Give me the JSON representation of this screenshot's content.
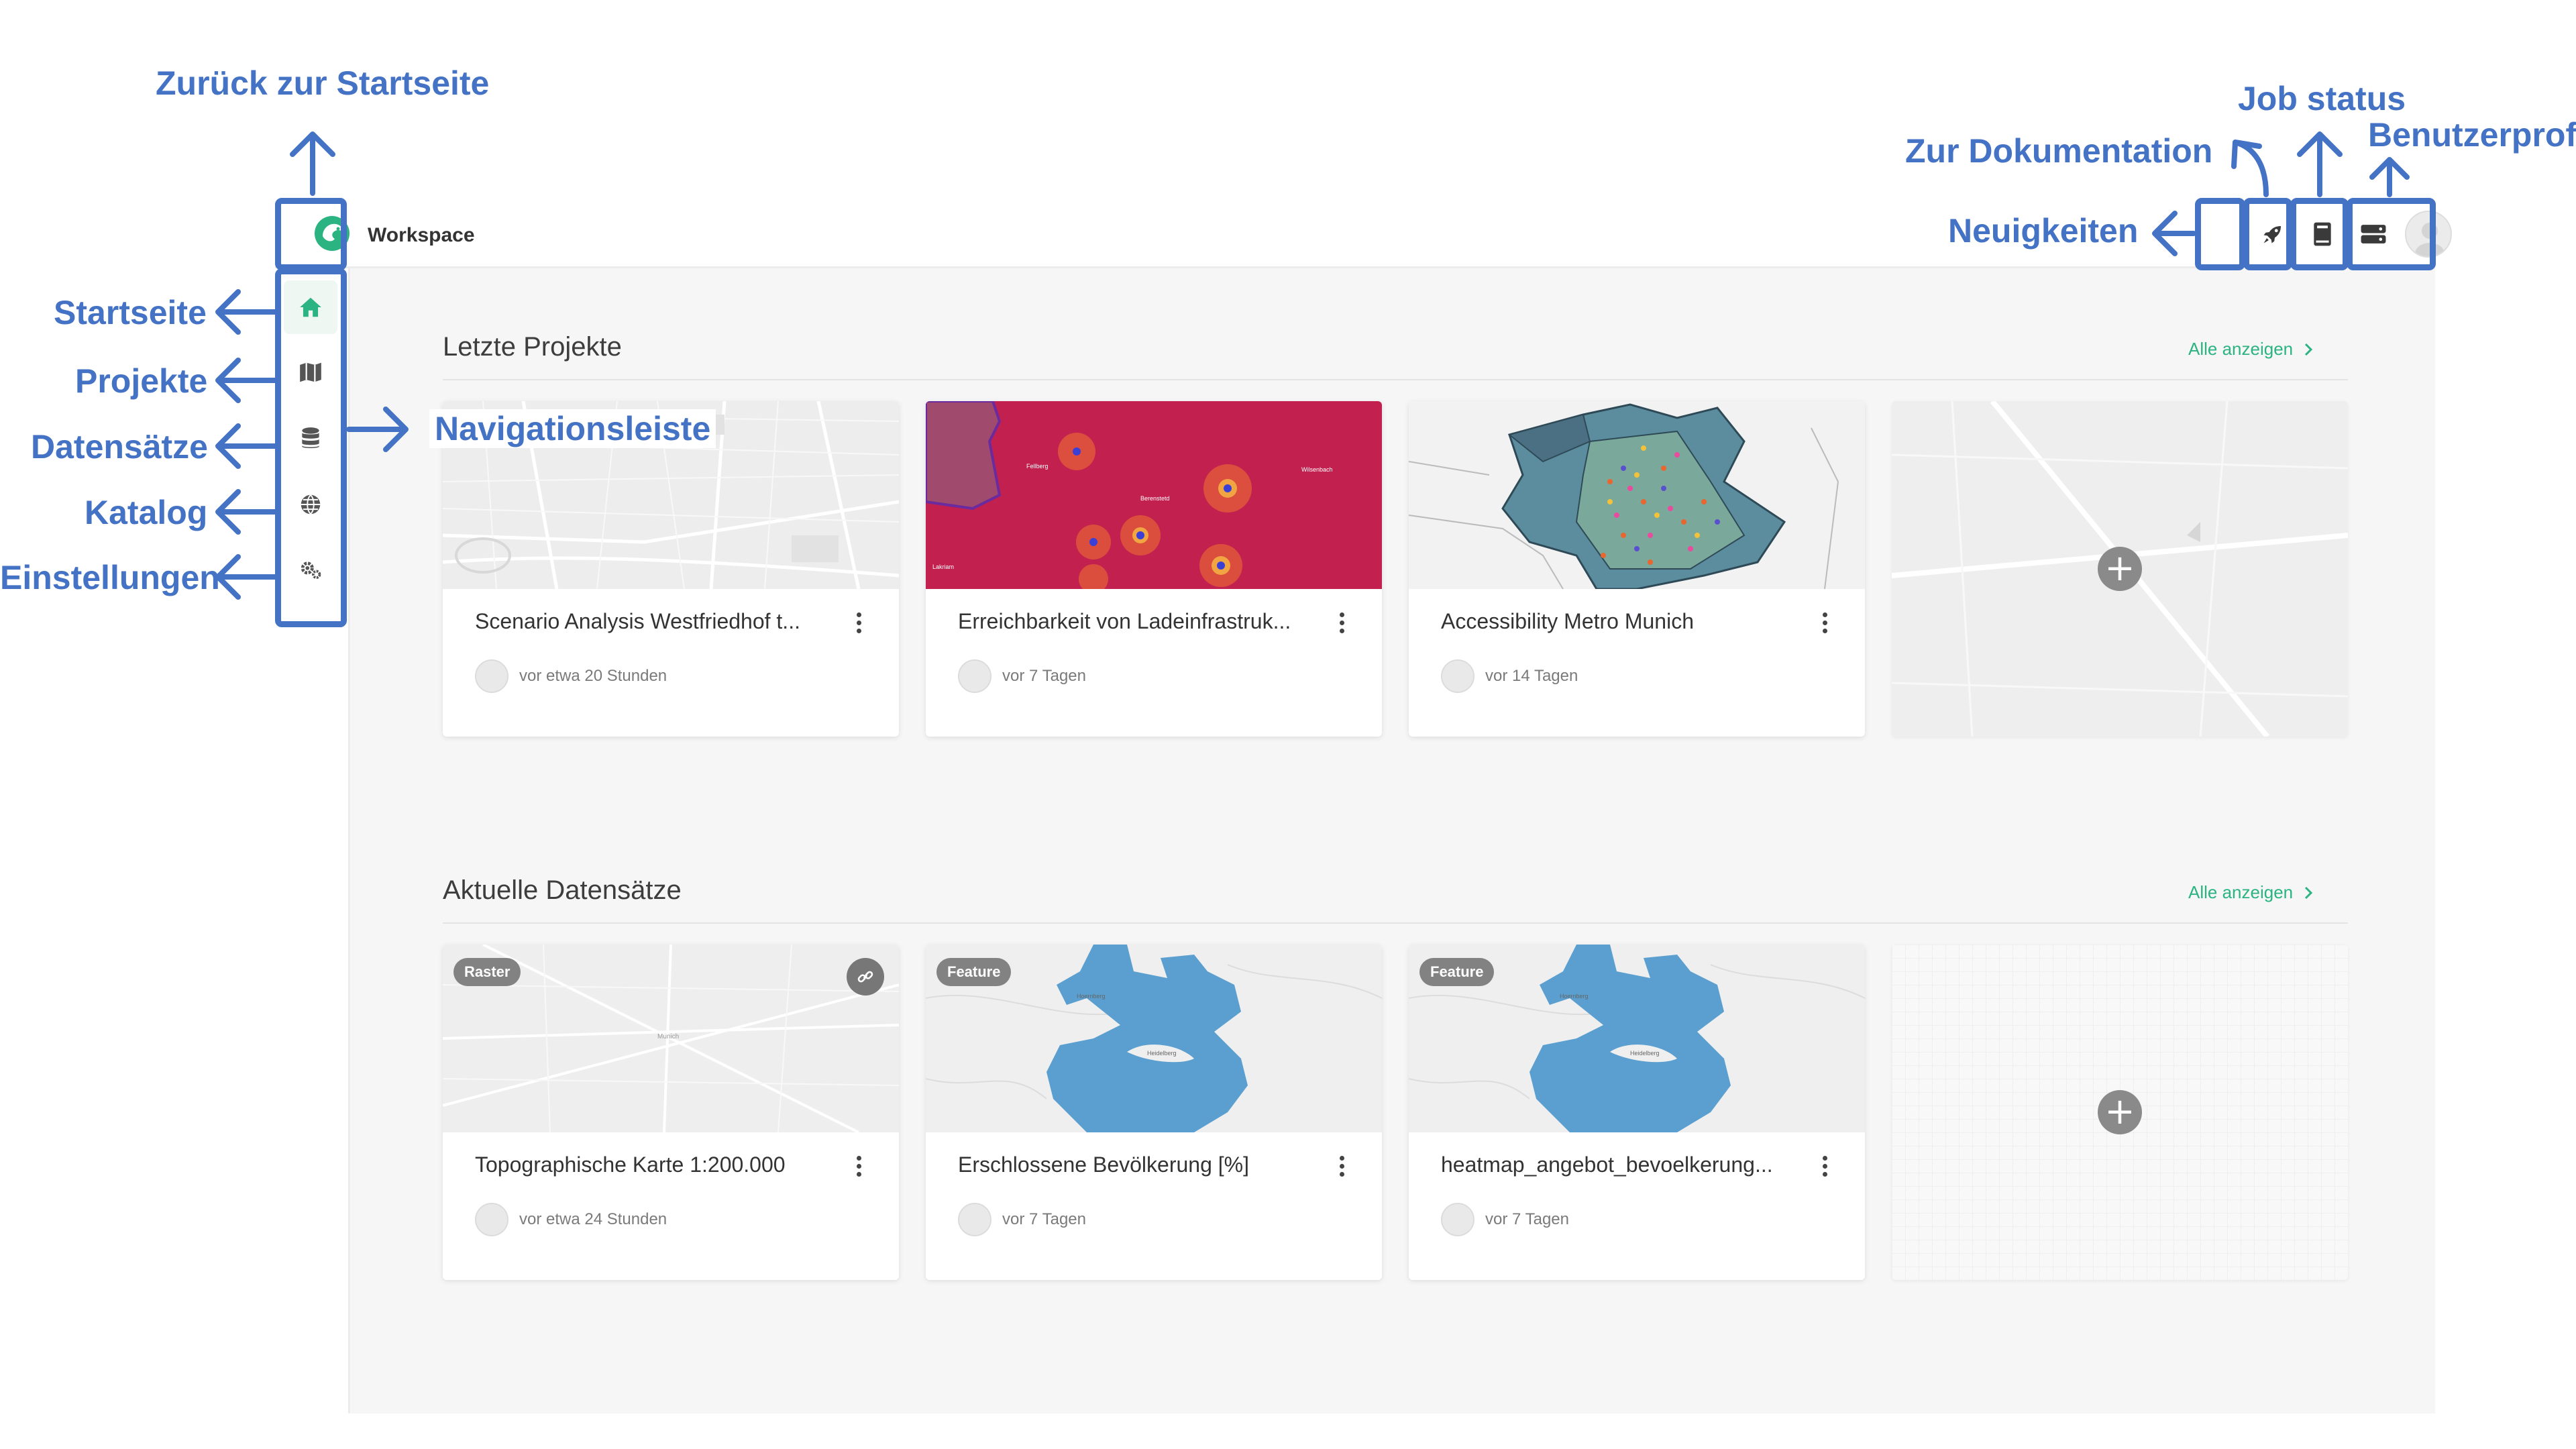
{
  "header": {
    "brand_name": "Workspace",
    "icons": [
      "rocket-icon",
      "book-icon",
      "server-icon",
      "user-avatar"
    ]
  },
  "sidebar": {
    "items": [
      {
        "id": "home",
        "icon": "home-icon",
        "active": true
      },
      {
        "id": "projects",
        "icon": "map-icon",
        "active": false
      },
      {
        "id": "datasets",
        "icon": "database-icon",
        "active": false
      },
      {
        "id": "catalog",
        "icon": "globe-icon",
        "active": false
      },
      {
        "id": "settings",
        "icon": "gears-icon",
        "active": false
      }
    ]
  },
  "recent_projects": {
    "title": "Letzte Projekte",
    "link": "Alle anzeigen",
    "cards": [
      {
        "title": "Scenario Analysis Westfriedhof t...",
        "time": "vor etwa 20 Stunden",
        "thumb": "grey-street-map"
      },
      {
        "title": "Erreichbarkeit von Ladeinfrastruk...",
        "time": "vor 7 Tagen",
        "thumb": "red-heatmap"
      },
      {
        "title": "Accessibility Metro Munich",
        "time": "vor 14 Tagen",
        "thumb": "district-map"
      }
    ]
  },
  "recent_datasets": {
    "title": "Aktuelle Datensätze",
    "link": "Alle anzeigen",
    "cards": [
      {
        "title": "Topographische Karte 1:200.000",
        "time": "vor etwa 24 Stunden",
        "badge": "Raster",
        "linked": true
      },
      {
        "title": "Erschlossene Bevölkerung [%]",
        "time": "vor 7 Tagen",
        "badge": "Feature",
        "linked": false
      },
      {
        "title": "heatmap_angebot_bevoelkerung...",
        "time": "vor 7 Tagen",
        "badge": "Feature",
        "linked": false
      }
    ]
  },
  "annotations": {
    "home": "Zurück zur Startseite",
    "startseite": "Startseite",
    "projekte": "Projekte",
    "datensaetze": "Datensätze",
    "katalog": "Katalog",
    "einstellungen": "Einstellungen",
    "navigationsleiste": "Navigationsleiste",
    "neuigkeiten": "Neuigkeiten",
    "dokumentation": "Zur Dokumentation",
    "job_status": "Job status",
    "benutzerprofil": "Benutzerprofil"
  },
  "colors": {
    "accent": "#2bb381",
    "annotation": "#4472c4",
    "feature_blue": "#5a9fcf",
    "heatmap_red": "#c2214f"
  }
}
